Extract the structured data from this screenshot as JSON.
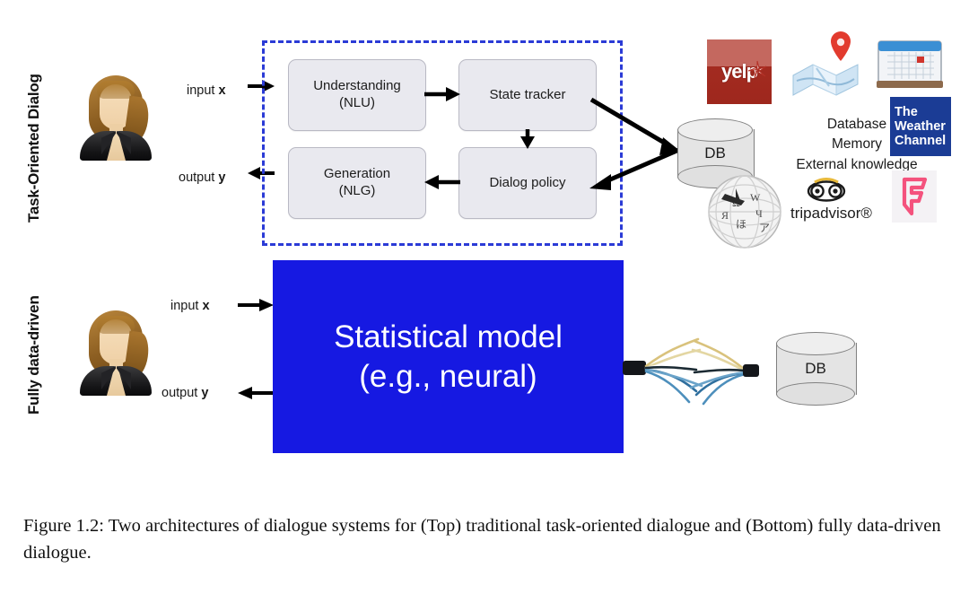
{
  "figure": {
    "caption": "Figure 1.2: Two architectures of dialogue systems for (Top) traditional task-oriented dialogue and (Bottom) fully data-driven dialogue.",
    "colors": {
      "dashed_border": "#2b3bd6",
      "model_box": "#1619e2",
      "process_box_fill": "#e9e9ef",
      "yelp_red": "#a32b20",
      "weather_blue": "#1b3c95",
      "foursquare_pink": "#f4527d"
    }
  },
  "top_section": {
    "row_label": "Task-Oriented Dialog",
    "user_icon": "user-avatar-icon",
    "input_label": "input",
    "input_var": "x",
    "output_label": "output",
    "output_var": "y",
    "boxes": [
      {
        "id": "nlu",
        "line1": "Understanding",
        "line2": "(NLU)"
      },
      {
        "id": "state-tracker",
        "line1": "State tracker",
        "line2": ""
      },
      {
        "id": "dialog-policy",
        "line1": "Dialog policy",
        "line2": ""
      },
      {
        "id": "nlg",
        "line1": "Generation",
        "line2": "(NLG)"
      }
    ],
    "db_label": "DB",
    "knowledge_lines": [
      "Database",
      "Memory",
      "External knowledge"
    ],
    "logos": [
      {
        "id": "yelp",
        "name": "yelp-logo",
        "text": "yelp"
      },
      {
        "id": "maps",
        "name": "map-icon",
        "text": ""
      },
      {
        "id": "calendar",
        "name": "calendar-icon",
        "text": ""
      },
      {
        "id": "weather",
        "name": "weather-channel-logo",
        "line1": "The",
        "line2": "Weather",
        "line3": "Channel"
      },
      {
        "id": "wikipedia",
        "name": "wikipedia-globe-icon",
        "text": ""
      },
      {
        "id": "tripadvisor",
        "name": "tripadvisor-logo",
        "text": "tripadvisor®"
      },
      {
        "id": "foursquare",
        "name": "foursquare-logo",
        "text": ""
      }
    ]
  },
  "bottom_section": {
    "row_label": "Fully data-driven",
    "user_icon": "user-avatar-icon",
    "input_label": "input",
    "input_var": "x",
    "output_label": "output",
    "output_var": "y",
    "model_line1": "Statistical model",
    "model_line2": "(e.g., neural)",
    "db_label": "DB",
    "connector": "frayed-cable-icon"
  }
}
